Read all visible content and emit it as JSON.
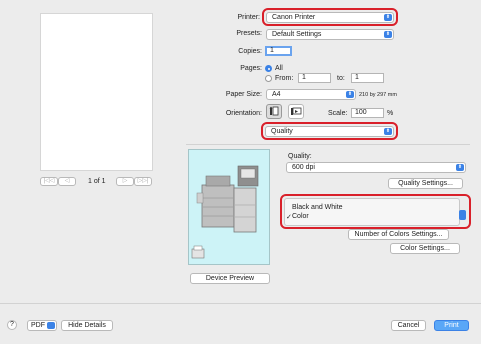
{
  "preview": {
    "page_text": "",
    "page_indicator": "1 of 1",
    "nav_first": "|◁◁",
    "nav_prev": "◁",
    "nav_next": "▷",
    "nav_last": "▷▷|"
  },
  "printer": {
    "label": "Printer:",
    "value": "Canon Printer"
  },
  "presets": {
    "label": "Presets:",
    "value": "Default Settings"
  },
  "copies": {
    "label": "Copies:",
    "value": "1"
  },
  "pages": {
    "label": "Pages:",
    "all_label": "All",
    "from_label": "From:",
    "from_value": "1",
    "to_label": "to:",
    "to_value": "1",
    "selected": "All"
  },
  "paper_size": {
    "label": "Paper Size:",
    "value": "A4",
    "dimensions": "210 by 297 mm"
  },
  "orientation": {
    "label": "Orientation:"
  },
  "scale": {
    "label": "Scale:",
    "value": "100",
    "unit": "%"
  },
  "section": {
    "value": "Quality"
  },
  "quality": {
    "label": "Quality:",
    "value": "600 dpi",
    "settings_button": "Quality Settings..."
  },
  "color_menu": {
    "items": [
      "Black and White",
      "Color"
    ],
    "checkmark": "✓",
    "selected_index": 1
  },
  "buttons": {
    "number_of_colors": "Number of Colors Settings...",
    "color_settings": "Color Settings...",
    "device_preview": "Device Preview",
    "help": "?",
    "pdf": "PDF",
    "hide_details": "Hide Details",
    "cancel": "Cancel",
    "print": "Print"
  },
  "colors": {
    "accent": "#3b82e6",
    "highlight": "#d9202a",
    "device_preview_bg": "#cdf3f7"
  },
  "icons": {
    "dropdown": "⬍",
    "checkmark": "✓"
  }
}
